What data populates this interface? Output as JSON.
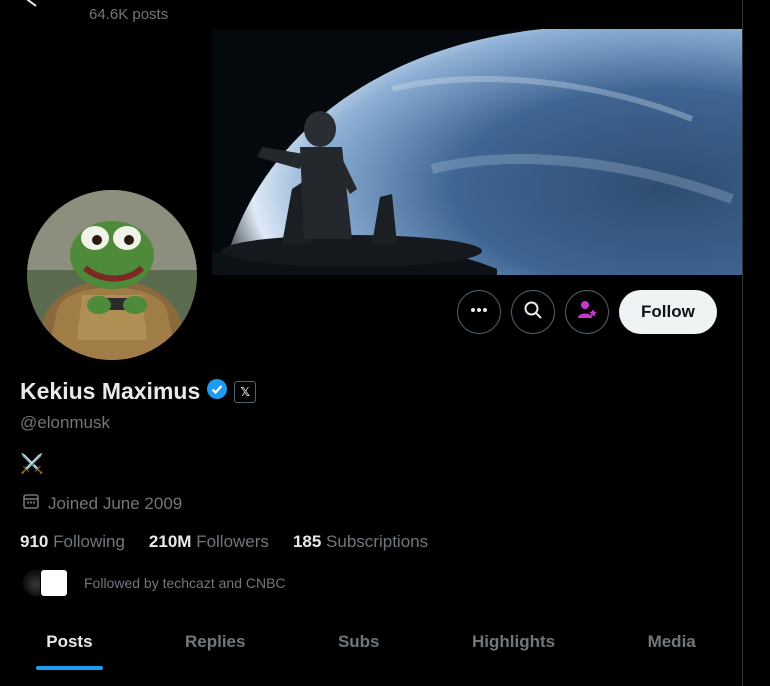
{
  "header": {
    "posts_count": "64.6K posts"
  },
  "profile": {
    "display_name": "Kekius Maximus",
    "handle": "@elonmusk",
    "bio": "⚔️",
    "joined": "Joined June 2009",
    "verified_color": "#1d9bf0",
    "badge_letter": "𝕏"
  },
  "actions": {
    "follow_label": "Follow",
    "more_icon": "more-icon",
    "search_icon": "search-icon",
    "subscribe_icon": "subscribe-icon"
  },
  "stats": [
    {
      "value": "910",
      "label": "Following"
    },
    {
      "value": "210M",
      "label": "Followers"
    },
    {
      "value": "185",
      "label": "Subscriptions"
    }
  ],
  "followed_by": "Followed by techcazt and CNBC",
  "tabs": [
    "Posts",
    "Replies",
    "Subs",
    "Highlights",
    "Media"
  ],
  "colors": {
    "accent": "#1d9bf0",
    "follow_bg": "#eff3f4",
    "subscribe": "#c936cc"
  }
}
